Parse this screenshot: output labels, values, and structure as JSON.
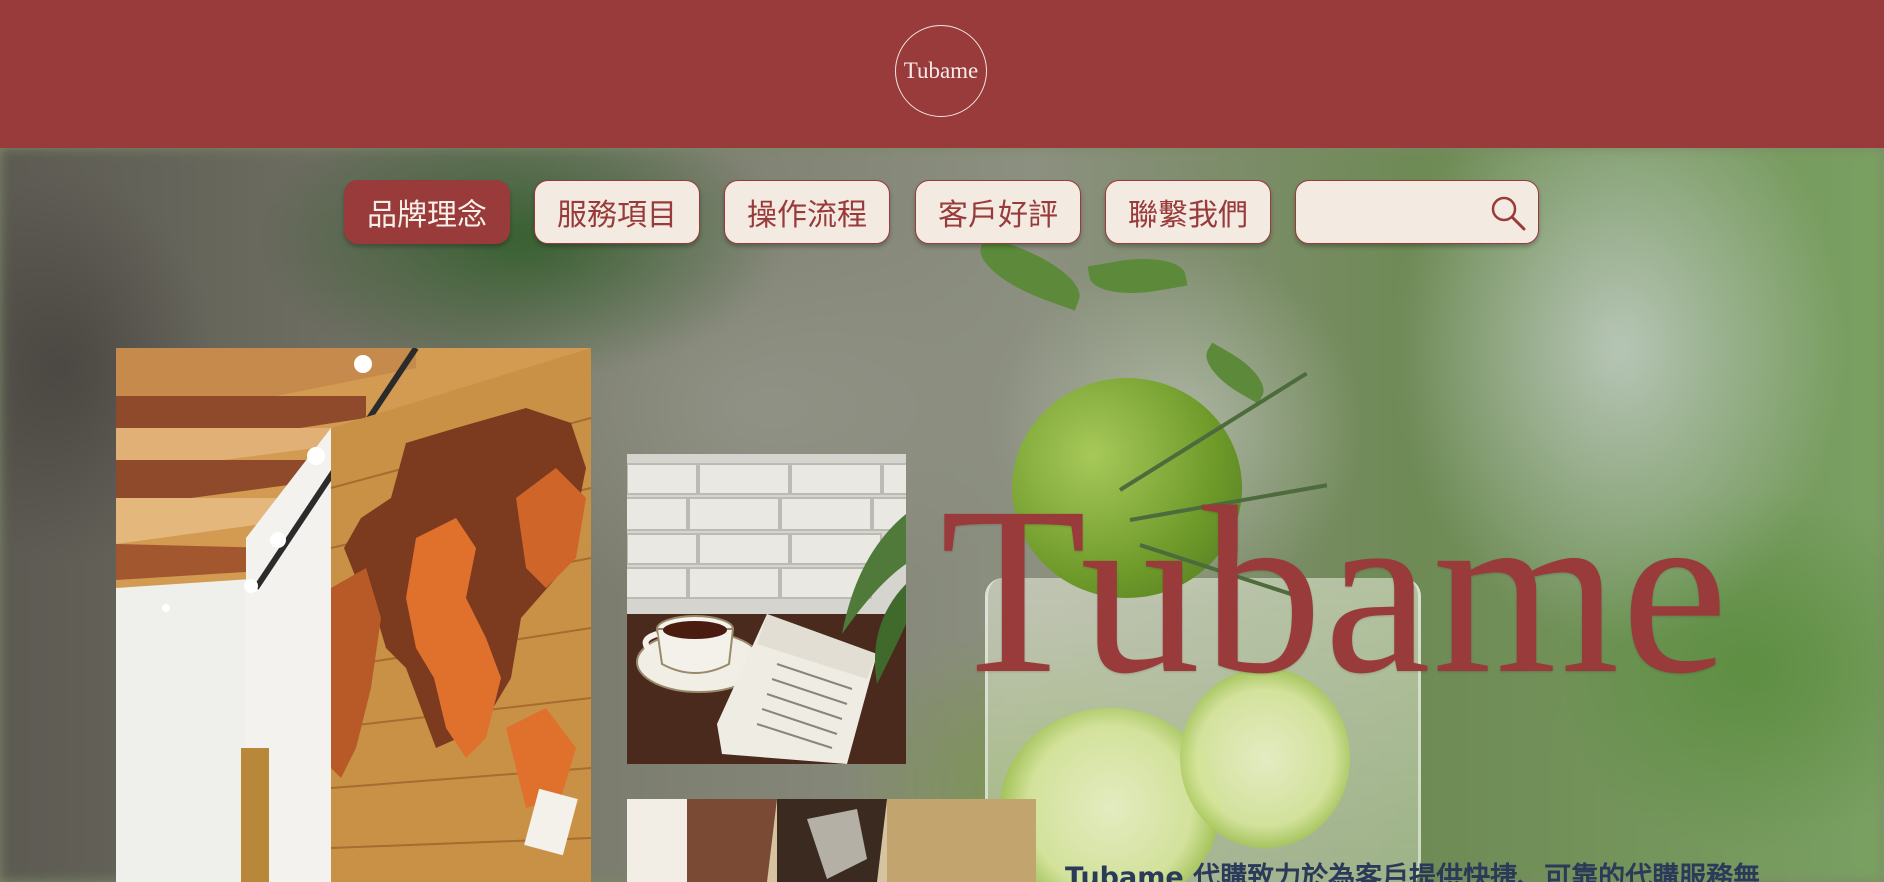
{
  "header": {
    "logo_text": "Tubame"
  },
  "nav": {
    "items": [
      {
        "label": "品牌理念",
        "active": true
      },
      {
        "label": "服務項目",
        "active": false
      },
      {
        "label": "操作流程",
        "active": false
      },
      {
        "label": "客戶好評",
        "active": false
      },
      {
        "label": "聯繫我們",
        "active": false
      }
    ],
    "search": {
      "value": "",
      "icon": "search-icon"
    }
  },
  "hero": {
    "title": "Tubame",
    "description": "Tubame 代購致力於為客戶提供快捷、可靠的代購服務無",
    "photos": [
      {
        "subject": "cafe-interior-world-map"
      },
      {
        "subject": "tea-cup-and-newspaper"
      },
      {
        "subject": "partial-photo"
      }
    ]
  },
  "colors": {
    "brand": "#993a3b",
    "button_bg": "#f3ebe1",
    "description_text": "#2a3a58"
  }
}
